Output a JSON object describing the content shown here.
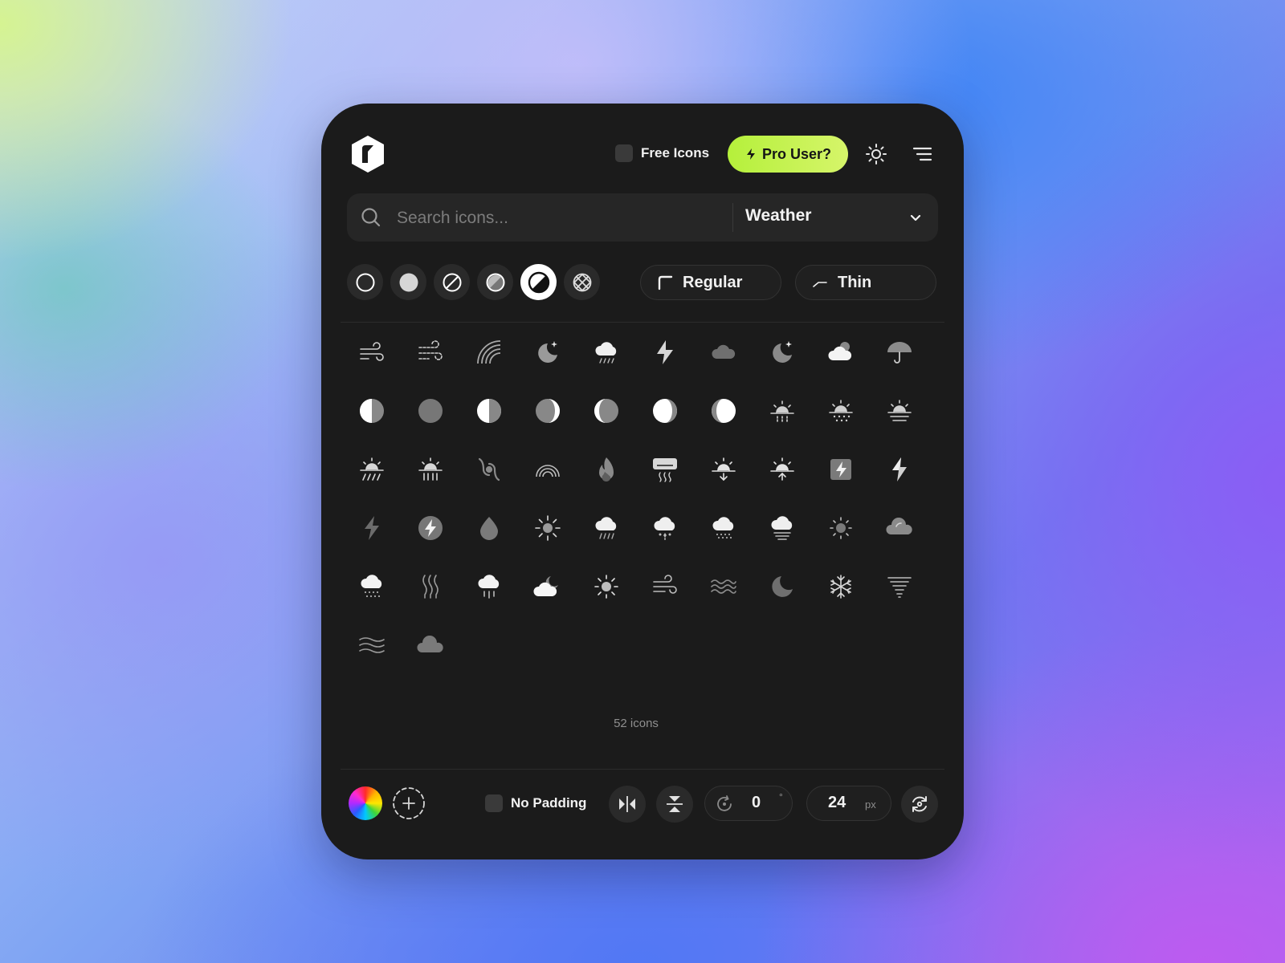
{
  "header": {
    "free_icons_label": "Free Icons",
    "free_icons_checked": false,
    "pro_label": "Pro User?",
    "pro_color": "#c6f24a"
  },
  "search": {
    "placeholder": "Search icons...",
    "category": "Weather"
  },
  "styles": {
    "options": [
      "outline-circle-icon",
      "solid-circle-icon",
      "slash-circle-icon",
      "duotone-circle-icon",
      "half-circle-icon",
      "pattern-circle-icon"
    ],
    "active": "half-circle-icon"
  },
  "weights": {
    "corner": "Regular",
    "stroke": "Thin"
  },
  "icons": [
    "wind-icon",
    "wind-gust-icon",
    "rainbow-icon",
    "moon-stars-icon",
    "cloud-rain-icon",
    "lightning-icon",
    "cloud-icon",
    "moon-star-icon",
    "cloud-sun-icon",
    "umbrella-icon",
    "moon-first-quarter-icon",
    "moon-full-icon",
    "moon-last-quarter-icon",
    "moon-waxing-crescent-icon",
    "moon-waning-crescent-icon",
    "moon-waxing-gibbous-icon",
    "moon-waning-gibbous-icon",
    "sunrise-rain-icon",
    "sunrise-snow-icon",
    "sunset-fog-icon",
    "sunrise-drizzle-icon",
    "sunrise-showers-icon",
    "hurricane-icon",
    "rainbow-outline-icon",
    "fire-icon",
    "air-conditioner-icon",
    "sunset-icon",
    "sunrise-icon",
    "lightning-square-icon",
    "lightning-bolt-icon",
    "lightning-thin-icon",
    "lightning-circle-icon",
    "droplet-icon",
    "sun-icon",
    "cloud-drizzle-icon",
    "cloud-hail-icon",
    "cloud-snow-icon",
    "cloud-fog-icon",
    "sun-dim-icon",
    "cloud-partial-icon",
    "cloud-snowflakes-icon",
    "heat-waves-icon",
    "cloud-heavy-rain-icon",
    "cloud-moon-icon",
    "sun-bright-icon",
    "wind-lines-icon",
    "waves-icon",
    "moon-icon",
    "snowflake-icon",
    "tornado-icon",
    "water-waves-icon",
    "cloud-solid-icon"
  ],
  "icon_count_label": "52 icons",
  "footer": {
    "no_padding_label": "No Padding",
    "no_padding_checked": false,
    "rotation_value": "0",
    "rotation_unit": "°",
    "size_value": "24",
    "size_unit": "px"
  }
}
